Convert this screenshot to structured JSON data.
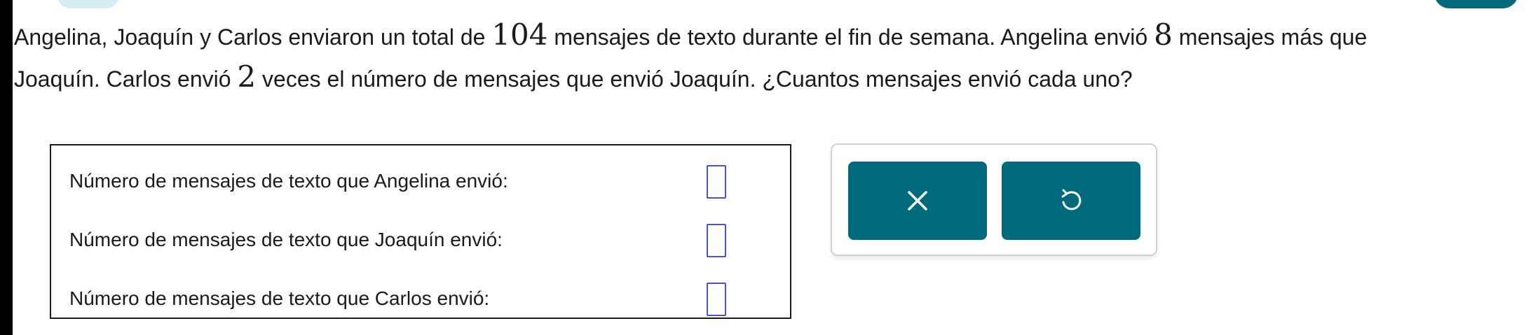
{
  "problem": {
    "line1_text_a": "Angelina, Joaquín y Carlos enviaron un total de ",
    "total": "104",
    "line1_text_b": " mensajes de texto durante el fin de semana. Angelina envió ",
    "difference": "8",
    "line1_text_c": " mensajes más que",
    "line2_text_a": "Joaquín. Carlos envió ",
    "multiplier": "2",
    "line2_text_b": " veces el número de mensajes que envió Joaquín. ¿Cuantos mensajes envió cada uno?"
  },
  "answers": [
    {
      "label": "Número de mensajes de texto que Angelina envió:",
      "value": ""
    },
    {
      "label": "Número de mensajes de texto que Joaquín envió:",
      "value": ""
    },
    {
      "label": "Número de mensajes de texto que Carlos envió:",
      "value": ""
    }
  ],
  "controls": {
    "clear_icon": "close-icon",
    "undo_icon": "undo-icon"
  },
  "colors": {
    "button_bg": "#006a7d",
    "input_border": "#4b4fd0",
    "tab_light": "#d4eef2"
  }
}
